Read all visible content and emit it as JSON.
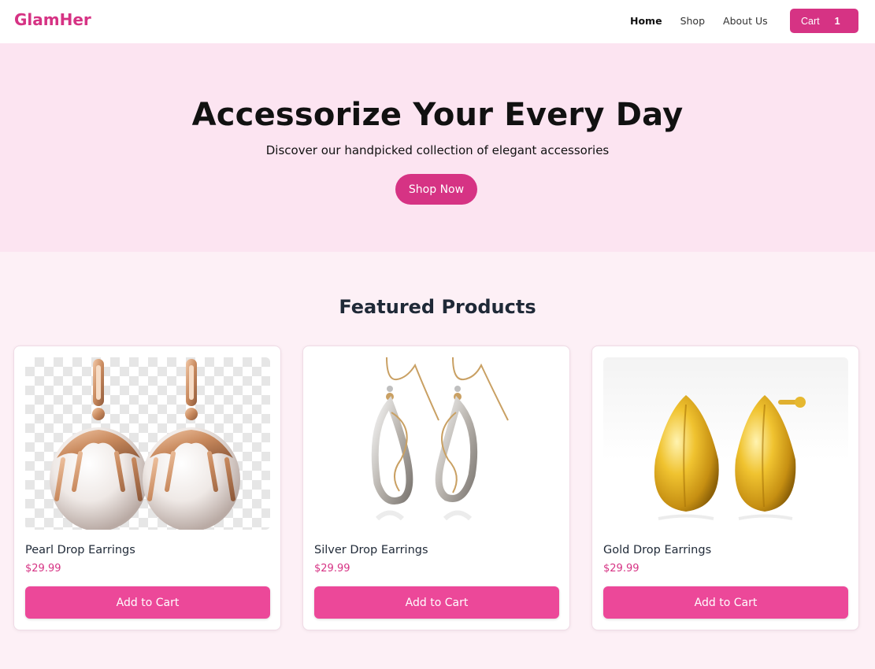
{
  "brand": {
    "name": "GlamHer",
    "color": "#d63384"
  },
  "nav": {
    "links": [
      {
        "label": "Home",
        "active": true
      },
      {
        "label": "Shop",
        "active": false
      },
      {
        "label": "About Us",
        "active": false
      }
    ],
    "cart": {
      "label": "Cart",
      "count": "1"
    }
  },
  "hero": {
    "title": "Accessorize Your Every Day",
    "subtitle": "Discover our handpicked collection of elegant accessories",
    "cta_label": "Shop Now",
    "background": "#fce4f1"
  },
  "featured": {
    "title": "Featured Products",
    "products": [
      {
        "name": "Pearl Drop Earrings",
        "price": "$29.99",
        "button_label": "Add to Cart",
        "image_icon": "pearl-earrings-image"
      },
      {
        "name": "Silver Drop Earrings",
        "price": "$29.99",
        "button_label": "Add to Cart",
        "image_icon": "silver-earrings-image"
      },
      {
        "name": "Gold Drop Earrings",
        "price": "$29.99",
        "button_label": "Add to Cart",
        "image_icon": "gold-earrings-image"
      }
    ]
  },
  "colors": {
    "accent": "#d63384",
    "button": "#ec4899",
    "page_bg": "#fdf0f6"
  }
}
